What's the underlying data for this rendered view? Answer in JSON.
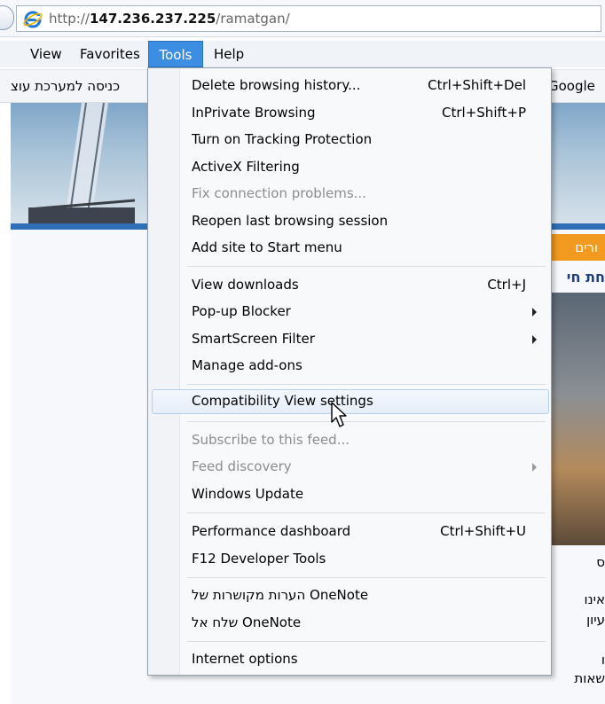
{
  "address": {
    "prefix": "http://",
    "host": "147.236.237.225",
    "path": "/ramatgan/"
  },
  "menubar": {
    "items": [
      {
        "label": "View"
      },
      {
        "label": "Favorites"
      },
      {
        "label": "Tools"
      },
      {
        "label": "Help"
      }
    ]
  },
  "favbar": {
    "hebrew_link": "כניסה למערכת עוצ",
    "google": "Google"
  },
  "page": {
    "orange_tab": "ורים",
    "heading": "חת חי",
    "side_lines": [
      "ס",
      "אינו",
      "עיון",
      "ו",
      "שאות"
    ]
  },
  "tools_menu": {
    "items": [
      {
        "label": "Delete browsing history...",
        "shortcut": "Ctrl+Shift+Del"
      },
      {
        "label": "InPrivate Browsing",
        "shortcut": "Ctrl+Shift+P"
      },
      {
        "label": "Turn on Tracking Protection",
        "shortcut": ""
      },
      {
        "label": "ActiveX Filtering",
        "shortcut": ""
      },
      {
        "label": "Fix connection problems...",
        "shortcut": "",
        "disabled": true
      },
      {
        "label": "Reopen last browsing session",
        "shortcut": ""
      },
      {
        "label": "Add site to Start menu",
        "shortcut": ""
      },
      {
        "label": "View downloads",
        "shortcut": "Ctrl+J"
      },
      {
        "label": "Pop-up Blocker",
        "shortcut": "",
        "submenu": true
      },
      {
        "label": "SmartScreen Filter",
        "shortcut": "",
        "submenu": true
      },
      {
        "label": "Manage add-ons",
        "shortcut": ""
      },
      {
        "label": "Compatibility View settings",
        "shortcut": "",
        "hover": true
      },
      {
        "label": "Subscribe to this feed...",
        "shortcut": "",
        "disabled": true
      },
      {
        "label": "Feed discovery",
        "shortcut": "",
        "disabled": true,
        "submenu": true
      },
      {
        "label": "Windows Update",
        "shortcut": ""
      },
      {
        "label": "Performance dashboard",
        "shortcut": "Ctrl+Shift+U"
      },
      {
        "label": "F12 Developer Tools",
        "shortcut": ""
      },
      {
        "label": "הערות מקושרות של OneNote",
        "shortcut": ""
      },
      {
        "label": "שלח אל OneNote",
        "shortcut": ""
      },
      {
        "label": "Internet options",
        "shortcut": ""
      }
    ]
  },
  "colors": {
    "menu_active": "#3c8ee3",
    "accent_orange": "#f29a1f",
    "page_stripe": "#2f6fb8"
  },
  "icons": {
    "browser": "internet-explorer-icon",
    "pointer": "mouse-cursor-icon"
  }
}
